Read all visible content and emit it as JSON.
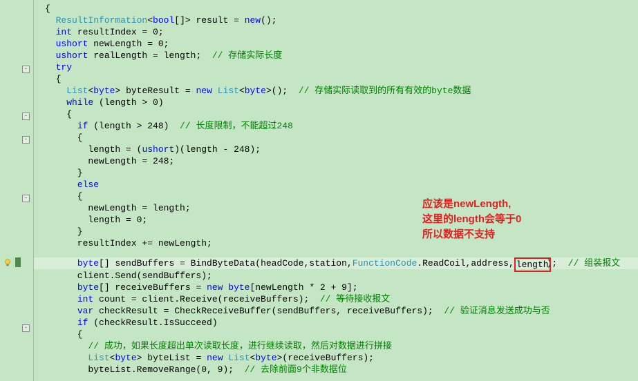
{
  "code": {
    "l1": "{",
    "l2a": "  ",
    "l2b": "ResultInformation",
    "l2c": "<",
    "l2d": "bool",
    "l2e": "[]> result = ",
    "l2f": "new",
    "l2g": "();",
    "l3a": "  ",
    "l3b": "int",
    "l3c": " resultIndex = 0;",
    "l4a": "  ",
    "l4b": "ushort",
    "l4c": " newLength = 0;",
    "l5a": "  ",
    "l5b": "ushort",
    "l5c": " realLength = length;  ",
    "l5d": "// 存储实际长度",
    "l6a": "  ",
    "l6b": "try",
    "l7": "  {",
    "l8a": "    ",
    "l8b": "List",
    "l8c": "<",
    "l8d": "byte",
    "l8e": "> byteResult = ",
    "l8f": "new",
    "l8g": " ",
    "l8h": "List",
    "l8i": "<",
    "l8j": "byte",
    "l8k": ">();  ",
    "l8l": "// 存储实际读取到的所有有效的byte数据",
    "l9a": "    ",
    "l9b": "while",
    "l9c": " (length > 0)",
    "l10": "    {",
    "l11a": "      ",
    "l11b": "if",
    "l11c": " (length > 248)  ",
    "l11d": "// 长度限制，不能超过248",
    "l12": "      {",
    "l13a": "        length = (",
    "l13b": "ushort",
    "l13c": ")(length - 248);",
    "l14": "        newLength = 248;",
    "l15": "      }",
    "l16a": "      ",
    "l16b": "else",
    "l17": "      {",
    "l18": "        newLength = length;",
    "l19": "        length = 0;",
    "l20": "      }",
    "l21": "      resultIndex += newLength;",
    "l22a": "      ",
    "l22b": "byte",
    "l22c": "[] sendBuffers = BindByteData(headCode,station,",
    "l22d": "FunctionCode",
    "l22e": ".ReadCoil,address,",
    "l22f": "length",
    "l22g": ");  ",
    "l22h": "// 组装报文",
    "l23": "      client.Send(sendBuffers);",
    "l24a": "      ",
    "l24b": "byte",
    "l24c": "[] receiveBuffers = ",
    "l24d": "new",
    "l24e": " ",
    "l24f": "byte",
    "l24g": "[newLength * 2 + 9];",
    "l25a": "      ",
    "l25b": "int",
    "l25c": " count = client.Receive(receiveBuffers);  ",
    "l25d": "// 等待接收报文",
    "l26a": "      ",
    "l26b": "var",
    "l26c": " checkResult = CheckReceiveBuffer(sendBuffers, receiveBuffers);  ",
    "l26d": "// 验证消息发送成功与否",
    "l27a": "      ",
    "l27b": "if",
    "l27c": " (checkResult.IsSucceed)",
    "l28": "      {",
    "l29a": "        ",
    "l29b": "// 成功，如果长度超出单次读取长度，进行继续读取，然后对数据进行拼接",
    "l30a": "        ",
    "l30b": "List",
    "l30c": "<",
    "l30d": "byte",
    "l30e": "> byteList = ",
    "l30f": "new",
    "l30g": " ",
    "l30h": "List",
    "l30i": "<",
    "l30j": "byte",
    "l30k": ">(receiveBuffers);",
    "l31a": "        byteList.RemoveRange(0, 9);  ",
    "l31b": "// 去除前面9个非数据位"
  },
  "anno": {
    "line1": "应该是newLength,",
    "line2": "这里的length会等于0",
    "line3": "所以数据不支持"
  }
}
